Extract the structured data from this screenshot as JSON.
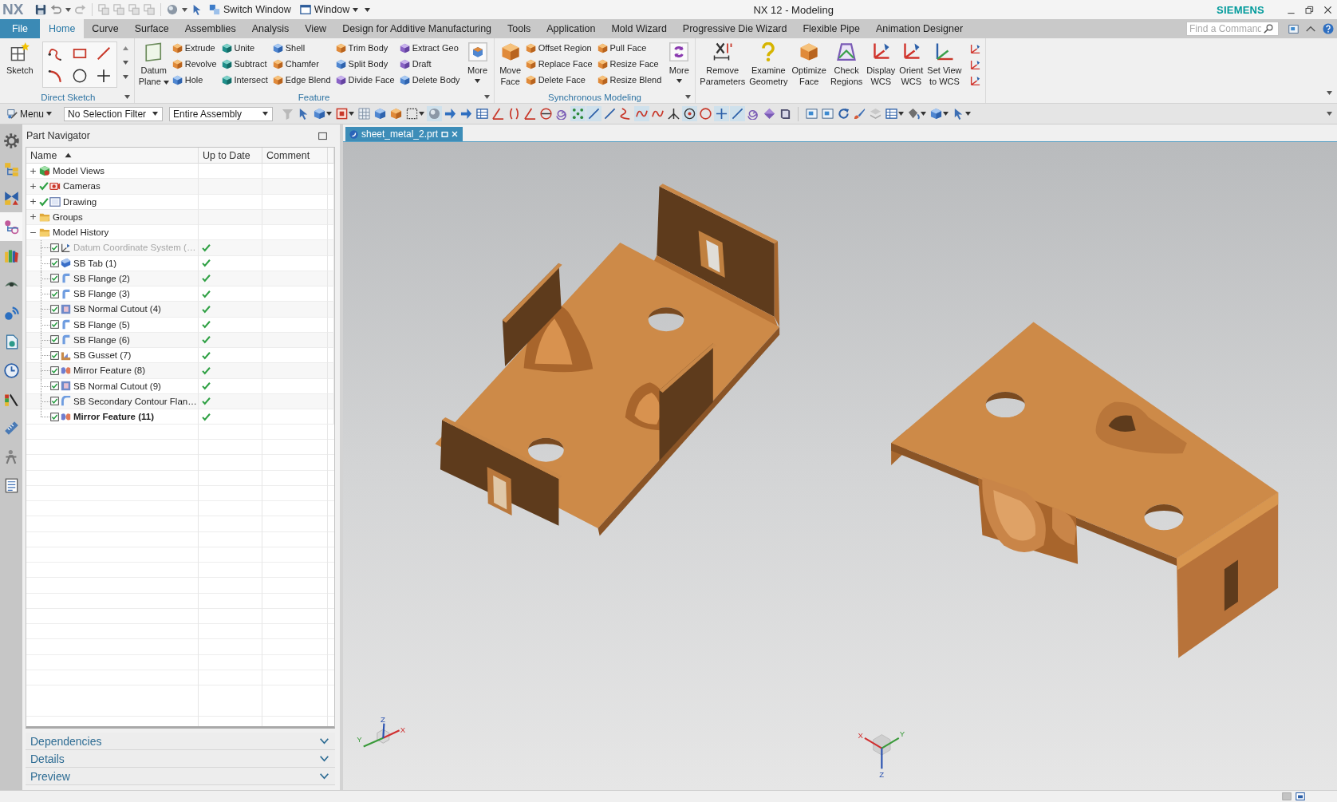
{
  "title_bar": {
    "logo": "NX",
    "switch_window": "Switch Window",
    "window_menu": "Window",
    "title": "NX 12 - Modeling",
    "brand": "SIEMENS"
  },
  "menu_tabs": [
    {
      "kind": "application",
      "label": "File",
      "selected": false
    },
    {
      "kind": "tab",
      "label": "Home",
      "selected": true
    },
    {
      "kind": "tab",
      "label": "Curve",
      "selected": false
    },
    {
      "kind": "tab",
      "label": "Surface",
      "selected": false
    },
    {
      "kind": "tab",
      "label": "Assemblies",
      "selected": false
    },
    {
      "kind": "tab",
      "label": "Analysis",
      "selected": false
    },
    {
      "kind": "tab",
      "label": "View",
      "selected": false
    },
    {
      "kind": "tab",
      "label": "Design for Additive Manufacturing",
      "selected": false
    },
    {
      "kind": "tab",
      "label": "Tools",
      "selected": false
    },
    {
      "kind": "tab",
      "label": "Application",
      "selected": false
    },
    {
      "kind": "tab",
      "label": "Mold Wizard",
      "selected": false
    },
    {
      "kind": "tab",
      "label": "Progressive Die Wizard",
      "selected": false
    },
    {
      "kind": "tab",
      "label": "Flexible Pipe",
      "selected": false
    },
    {
      "kind": "tab",
      "label": "Animation Designer",
      "selected": false
    }
  ],
  "command_finder": {
    "placeholder": "Find a Command"
  },
  "ribbon": {
    "groups": [
      {
        "label": "Direct Sketch",
        "launcher": true,
        "commands": [
          {
            "kind": "large",
            "label": "Sketch",
            "menu": false
          },
          {
            "kind": "gallery",
            "menu": false
          }
        ]
      },
      {
        "label": "Feature",
        "launcher": true,
        "commands": [
          {
            "kind": "large",
            "label": "Datum\nPlane",
            "menu": true
          },
          {
            "kind": "small",
            "label": "Extrude",
            "menu": false
          },
          {
            "kind": "small",
            "label": "Revolve",
            "menu": false
          },
          {
            "kind": "small",
            "label": "Hole",
            "menu": false
          },
          {
            "kind": "small",
            "label": "Unite",
            "menu": false
          },
          {
            "kind": "small",
            "label": "Subtract",
            "menu": false
          },
          {
            "kind": "small",
            "label": "Intersect",
            "menu": false
          },
          {
            "kind": "small",
            "label": "Shell",
            "menu": false
          },
          {
            "kind": "small",
            "label": "Chamfer",
            "menu": false
          },
          {
            "kind": "small",
            "label": "Edge Blend",
            "menu": false
          },
          {
            "kind": "small",
            "label": "Trim Body",
            "menu": false
          },
          {
            "kind": "small",
            "label": "Split Body",
            "menu": false
          },
          {
            "kind": "small",
            "label": "Divide Face",
            "menu": false
          },
          {
            "kind": "small",
            "label": "Extract Geo",
            "menu": false
          },
          {
            "kind": "small",
            "label": "Draft",
            "menu": false
          },
          {
            "kind": "small",
            "label": "Delete Body",
            "menu": false
          },
          {
            "kind": "large",
            "label": "More",
            "menu": true
          }
        ]
      },
      {
        "label": "Synchronous Modeling",
        "launcher": true,
        "commands": [
          {
            "kind": "large",
            "label": "Move\nFace",
            "menu": false
          },
          {
            "kind": "small",
            "label": "Offset Region",
            "menu": false
          },
          {
            "kind": "small",
            "label": "Replace Face",
            "menu": false
          },
          {
            "kind": "small",
            "label": "Delete Face",
            "menu": false
          },
          {
            "kind": "small",
            "label": "Pull Face",
            "menu": false
          },
          {
            "kind": "small",
            "label": "Resize Face",
            "menu": false
          },
          {
            "kind": "small",
            "label": "Resize Blend",
            "menu": false
          },
          {
            "kind": "large",
            "label": "More",
            "menu": true
          }
        ]
      },
      {
        "launcher": false,
        "commands": [
          {
            "kind": "large",
            "label": "Remove\nParameters",
            "menu": false
          },
          {
            "kind": "large",
            "label": "Examine\nGeometry",
            "menu": false
          },
          {
            "kind": "large",
            "label": "Optimize\nFace",
            "menu": false
          },
          {
            "kind": "large",
            "label": "Check\nRegions",
            "menu": false
          },
          {
            "kind": "large",
            "label": "Display\nWCS",
            "menu": false
          },
          {
            "kind": "large",
            "label": "Orient\nWCS",
            "menu": false
          },
          {
            "kind": "large",
            "label": "Set View\nto WCS",
            "menu": false
          },
          {
            "kind": "icon",
            "menu": false
          },
          {
            "kind": "icon",
            "menu": false
          },
          {
            "kind": "icon",
            "menu": false
          }
        ]
      }
    ]
  },
  "selection_bar": {
    "menu": "Menu",
    "filters": [
      {
        "value": "No Selection Filter"
      },
      {
        "value": "Entire Assembly"
      }
    ]
  },
  "resource_bar": [
    {
      "kind": "gear",
      "selected": false
    },
    {
      "kind": "assembly-tree",
      "selected": false
    },
    {
      "kind": "bowtie",
      "selected": false
    },
    {
      "kind": "feature-tree",
      "selected": true
    },
    {
      "kind": "books",
      "selected": false
    },
    {
      "kind": "eye",
      "selected": false
    },
    {
      "kind": "signal",
      "selected": false
    },
    {
      "kind": "page",
      "selected": false
    },
    {
      "kind": "clock",
      "selected": false
    },
    {
      "kind": "palette",
      "selected": false
    },
    {
      "kind": "ruler",
      "selected": false
    },
    {
      "kind": "figure",
      "selected": false
    },
    {
      "kind": "list",
      "selected": false
    }
  ],
  "part_navigator": {
    "title": "Part Navigator",
    "columns": [
      {
        "label": "Name",
        "sorted": true
      },
      {
        "label": "Up to Date",
        "sorted": false
      },
      {
        "label": "Comment",
        "sorted": false
      }
    ],
    "nodes": [
      {
        "kind": "model-views",
        "label": "Model Views",
        "expanded": false,
        "ticked": false
      },
      {
        "kind": "cameras",
        "label": "Cameras",
        "expanded": false,
        "ticked": true
      },
      {
        "kind": "drawing",
        "label": "Drawing",
        "expanded": false,
        "ticked": true
      },
      {
        "kind": "folder",
        "label": "Groups",
        "expanded": false,
        "ticked": false
      },
      {
        "kind": "folder",
        "label": "Model History",
        "expanded": true,
        "ticked": false,
        "children": [
          {
            "kind": "datum",
            "label": "Datum Coordinate System (…",
            "checked": true,
            "dimmed": true,
            "current": false,
            "up_to_date": true
          },
          {
            "kind": "tab",
            "label": "SB Tab (1)",
            "checked": true,
            "dimmed": false,
            "current": false,
            "up_to_date": true
          },
          {
            "kind": "flange",
            "label": "SB Flange (2)",
            "checked": true,
            "dimmed": false,
            "current": false,
            "up_to_date": true
          },
          {
            "kind": "flange",
            "label": "SB Flange (3)",
            "checked": true,
            "dimmed": false,
            "current": false,
            "up_to_date": true
          },
          {
            "kind": "cutout",
            "label": "SB Normal Cutout (4)",
            "checked": true,
            "dimmed": false,
            "current": false,
            "up_to_date": true
          },
          {
            "kind": "flange",
            "label": "SB Flange (5)",
            "checked": true,
            "dimmed": false,
            "current": false,
            "up_to_date": true
          },
          {
            "kind": "flange",
            "label": "SB Flange (6)",
            "checked": true,
            "dimmed": false,
            "current": false,
            "up_to_date": true
          },
          {
            "kind": "gusset",
            "label": "SB Gusset (7)",
            "checked": true,
            "dimmed": false,
            "current": false,
            "up_to_date": true
          },
          {
            "kind": "mirror",
            "label": "Mirror Feature (8)",
            "checked": true,
            "dimmed": false,
            "current": false,
            "up_to_date": true
          },
          {
            "kind": "cutout",
            "label": "SB Normal Cutout (9)",
            "checked": true,
            "dimmed": false,
            "current": false,
            "up_to_date": true
          },
          {
            "kind": "contour-flange",
            "label": "SB Secondary Contour Flan…",
            "checked": true,
            "dimmed": false,
            "current": false,
            "up_to_date": true
          },
          {
            "kind": "mirror",
            "label": "Mirror Feature (11)",
            "checked": true,
            "dimmed": false,
            "current": true,
            "up_to_date": true
          }
        ]
      }
    ],
    "panels": [
      {
        "label": "Dependencies",
        "expanded": false
      },
      {
        "label": "Details",
        "expanded": false
      },
      {
        "label": "Preview",
        "expanded": false
      }
    ]
  },
  "viewport": {
    "tabs": [
      {
        "label": "sheet_metal_2.prt",
        "selected": true
      }
    ],
    "triads": [
      {
        "kind": "view",
        "labels": [
          "X",
          "Y",
          "Z"
        ]
      },
      {
        "kind": "absolute",
        "labels": [
          "X",
          "Y",
          "Z"
        ]
      }
    ]
  }
}
